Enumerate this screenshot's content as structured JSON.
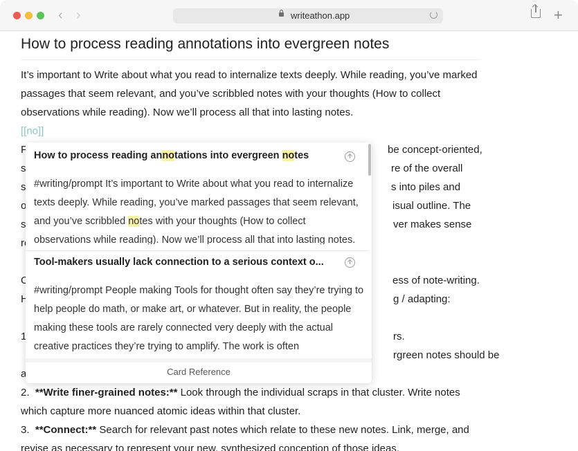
{
  "browser": {
    "url": "writeathon.app"
  },
  "doc": {
    "title": "How to process reading annotations into evergreen notes",
    "lines": [
      "It’s important to Write about what you read to internalize texts deeply. While reading, you’ve marked",
      "passages that seem relevant, and you’ve scribbled notes with your thoughts (How to collect",
      "observations while reading). Now we’ll process all that into lasting notes.",
      "[[no]]"
    ],
    "left_fragments": [
      "F",
      "s",
      "s",
      "o",
      "s",
      "re",
      "",
      "O",
      "H",
      "",
      "1",
      "",
      "a"
    ],
    "right_fragments": [
      "be concept-oriented,",
      "re of the overall",
      "s into piles and",
      "isual outline. The",
      "ver makes sense",
      "ess of note-writing.",
      "g / adapting:",
      "rs.",
      "rgreen notes should be"
    ],
    "item2_num": "2.",
    "item2_bold": "**Write finer-grained notes:**",
    "item2_text": "Look through the individual scraps in that cluster. Write notes",
    "item2_cont": "which capture more nuanced atomic ideas within that cluster.",
    "item3_num": "3.",
    "item3_bold": "**Connect:**",
    "item3_text": "Search for relevant past notes which relate to these new notes. Link, merge, and",
    "item3_cont": "revise as necessary to represent your new, synthesized conception of those ideas."
  },
  "popup": {
    "cards": [
      {
        "title_parts": [
          "How to process reading an",
          "no",
          "tations into evergreen ",
          "no",
          "tes"
        ],
        "body_pre": "#writing/prompt It’s important to Write about what you read to internalize texts deeply. While reading, you’ve marked passages that seem relevant, and you’ve scribbled ",
        "body_hl": "no",
        "body_post": "tes with your thoughts (How to collect observations while reading). Now we’ll process all that into lasting notes."
      },
      {
        "title": "Tool-makers usually lack connection to a serious context o...",
        "body": "#writing/prompt People making Tools for thought often say they’re trying to help people do math, or make art, or whatever. But in reality, the people making these tools are rarely connected very deeply with the actual creative practices they’re trying to amplify. The work is often"
      }
    ],
    "footer": "Card Reference"
  }
}
